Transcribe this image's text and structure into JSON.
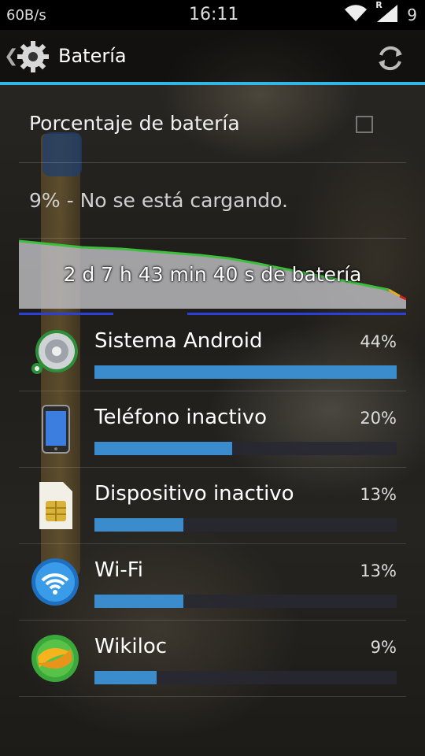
{
  "status_bar": {
    "net_speed": "60B/s",
    "time": "16:11",
    "roaming_indicator": "R",
    "battery_level": "9",
    "icons": [
      "wifi-icon",
      "signal-icon"
    ]
  },
  "action_bar": {
    "title": "Batería",
    "up_icon": "caret-left-icon",
    "app_icon": "gear-icon",
    "refresh_icon": "refresh-icon"
  },
  "preferences": {
    "battery_percentage_label": "Porcentaje de batería",
    "battery_percentage_checked": false
  },
  "battery_status": "9% - No se está cargando.",
  "history": {
    "label": "2 d 7 h 43 min 40 s de batería"
  },
  "apps": [
    {
      "name": "Sistema Android",
      "percent_label": "44%",
      "percent": 44,
      "icon": "android-system-icon"
    },
    {
      "name": "Teléfono inactivo",
      "percent_label": "20%",
      "percent": 20,
      "icon": "phone-icon"
    },
    {
      "name": "Dispositivo inactivo",
      "percent_label": "13%",
      "percent": 13,
      "icon": "sim-card-icon"
    },
    {
      "name": "Wi-Fi",
      "percent_label": "13%",
      "percent": 13,
      "icon": "wifi-icon"
    },
    {
      "name": "Wikiloc",
      "percent_label": "9%",
      "percent": 9,
      "icon": "wikiloc-icon"
    }
  ],
  "colors": {
    "accent": "#33b5e5",
    "usage_bar": "#3a8ccc",
    "graph_line_good": "#3cbf3c",
    "graph_line_low": "#e0b020",
    "graph_line_critical": "#d02020"
  }
}
